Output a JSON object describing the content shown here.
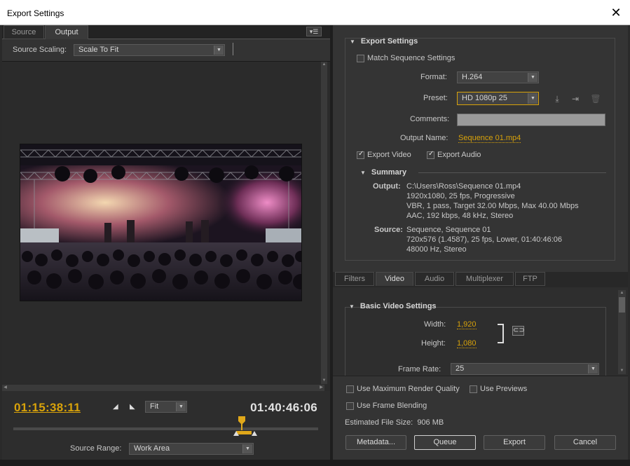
{
  "window": {
    "title": "Export Settings",
    "close_glyph": "✕"
  },
  "left": {
    "tabs": [
      {
        "label": "Source",
        "active": false
      },
      {
        "label": "Output",
        "active": true
      }
    ],
    "source_scaling": {
      "label": "Source Scaling:",
      "value": "Scale To Fit"
    },
    "timecode_current": "01:15:38:11",
    "timecode_duration": "01:40:46:06",
    "fit_zoom": "Fit",
    "source_range": {
      "label": "Source Range:",
      "value": "Work Area"
    }
  },
  "export_settings": {
    "heading": "Export Settings",
    "match_sequence": {
      "label": "Match Sequence Settings",
      "checked": false
    },
    "format": {
      "label": "Format:",
      "value": "H.264"
    },
    "preset": {
      "label": "Preset:",
      "value": "HD 1080p 25"
    },
    "comments": {
      "label": "Comments:",
      "value": ""
    },
    "output_name": {
      "label": "Output Name:",
      "value": "Sequence 01.mp4"
    },
    "export_video": {
      "label": "Export Video",
      "checked": true
    },
    "export_audio": {
      "label": "Export Audio",
      "checked": true
    }
  },
  "summary": {
    "heading": "Summary",
    "output_label": "Output:",
    "output_lines": [
      "C:\\Users\\Ross\\Sequence 01.mp4",
      "1920x1080, 25 fps, Progressive",
      "VBR, 1 pass, Target 32.00 Mbps, Max 40.00 Mbps",
      "AAC, 192 kbps, 48 kHz, Stereo"
    ],
    "source_label": "Source:",
    "source_lines": [
      "Sequence, Sequence 01",
      "720x576 (1.4587), 25 fps, Lower, 01:40:46:06",
      "48000 Hz, Stereo"
    ]
  },
  "settings_tabs": [
    {
      "label": "Filters",
      "active": false
    },
    {
      "label": "Video",
      "active": true
    },
    {
      "label": "Audio",
      "active": false
    },
    {
      "label": "Multiplexer",
      "active": false
    },
    {
      "label": "FTP",
      "active": false
    }
  ],
  "basic_video": {
    "heading": "Basic Video Settings",
    "width": {
      "label": "Width:",
      "value": "1,920"
    },
    "height": {
      "label": "Height:",
      "value": "1,080"
    },
    "frame_rate": {
      "label": "Frame Rate:",
      "value": "25"
    }
  },
  "bottom": {
    "max_render_quality": {
      "label": "Use Maximum Render Quality",
      "checked": false
    },
    "use_previews": {
      "label": "Use Previews",
      "checked": false
    },
    "frame_blending": {
      "label": "Use Frame Blending",
      "checked": false
    },
    "estimated_size": "Estimated File Size:  906 MB",
    "buttons": {
      "metadata": "Metadata...",
      "queue": "Queue",
      "export": "Export",
      "cancel": "Cancel"
    }
  },
  "colors": {
    "accent_timecode": "#d8a20a",
    "panel": "#343434",
    "preset_focus": "#d8a20a"
  }
}
